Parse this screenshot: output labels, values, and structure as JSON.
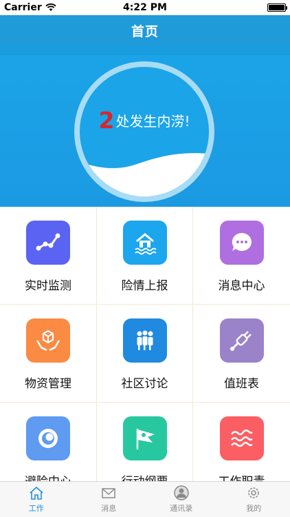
{
  "status_bar": {
    "carrier": "Carrier",
    "time": "4:22 PM"
  },
  "nav": {
    "title": "首页"
  },
  "hero": {
    "alert_count": "2",
    "alert_text": "处发生内涝!"
  },
  "grid": {
    "items": [
      {
        "label": "实时监测",
        "icon": "trend-chart-icon",
        "color": "#5b63f2"
      },
      {
        "label": "险情上报",
        "icon": "flooded-house-icon",
        "color": "#1ba6ee"
      },
      {
        "label": "消息中心",
        "icon": "chat-bubble-icon",
        "color": "#b06fe0"
      },
      {
        "label": "物资管理",
        "icon": "hands-box-icon",
        "color": "#fb8a43"
      },
      {
        "label": "社区讨论",
        "icon": "group-people-icon",
        "color": "#1f8ae0"
      },
      {
        "label": "值班表",
        "icon": "plug-icon",
        "color": "#9a83c8"
      },
      {
        "label": "避险中心",
        "icon": "ring-target-icon",
        "color": "#5f9bf1"
      },
      {
        "label": "行动纲要",
        "icon": "flag-icon",
        "color": "#27c8a0"
      },
      {
        "label": "工作职责",
        "icon": "waves-icon",
        "color": "#fb5e63"
      }
    ]
  },
  "tab_bar": {
    "items": [
      {
        "label": "工作",
        "icon": "home-icon",
        "active": true
      },
      {
        "label": "消息",
        "icon": "mail-icon",
        "active": false
      },
      {
        "label": "通讯录",
        "icon": "contact-icon",
        "active": false
      },
      {
        "label": "我的",
        "icon": "gear-icon",
        "active": false
      }
    ]
  },
  "colors": {
    "primary": "#1f9bd9",
    "hero": "#1ba4e8",
    "alert": "#d8262a",
    "active_tab": "#1f8fd6",
    "inactive_tab": "#8a8a8a"
  }
}
